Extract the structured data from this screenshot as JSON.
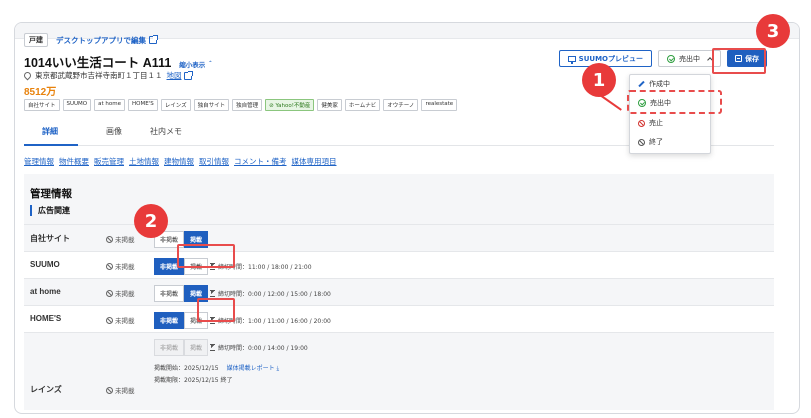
{
  "header": {
    "badge": "戸建",
    "edit_link": "デスクトップアプリで編集",
    "title": "1014いい生活コート A111",
    "collapse": "縮小表示 ＾",
    "address": "東京都武蔵野市吉祥寺南町１丁目１１",
    "map_link": "地図",
    "price": "8512万"
  },
  "media_tags": [
    "自社サイト",
    "SUUMO",
    "at home",
    "HOME'S",
    "レインズ",
    "独自サイト",
    "独自管理",
    "Yahoo!不動産",
    "健美家",
    "ホームナビ",
    "オウチーノ",
    "realestate"
  ],
  "tabs": [
    "詳細",
    "画像",
    "社内メモ"
  ],
  "anchors": [
    "管理情報",
    "物件概要",
    "販売管理",
    "土地情報",
    "建物情報",
    "取引情報",
    "コメント・備考",
    "媒体専用項目"
  ],
  "actions": {
    "suumo": "SUUMOプレビュー",
    "status": "売出中",
    "save": "保存"
  },
  "dropdown": [
    "作成中",
    "売出中",
    "売止",
    "終了"
  ],
  "panel": {
    "title": "管理情報",
    "subtitle": "広告関連"
  },
  "toggle_labels": {
    "off": "非掲載",
    "on": "掲載"
  },
  "rows": [
    {
      "name": "自社サイト",
      "status": "未掲載",
      "active": "on",
      "deadline": ""
    },
    {
      "name": "SUUMO",
      "status": "未掲載",
      "active": "off",
      "deadline": "締切時間：11:00 / 18:00 / 21:00"
    },
    {
      "name": "at home",
      "status": "未掲載",
      "active": "on",
      "deadline": "締切時間：0:00 / 12:00 / 15:00 / 18:00"
    },
    {
      "name": "HOME'S",
      "status": "未掲載",
      "active": "off",
      "deadline": "締切時間：1:00 / 11:00 / 16:00 / 20:00"
    },
    {
      "name": "レインズ",
      "status": "未掲載",
      "active": "disabled",
      "deadline": "締切時間：0:00 / 14:00 / 19:00",
      "start": "掲載開始：2025/12/15",
      "report": "媒体掲載レポート ⤓",
      "end": "掲載期限：2025/12/15 終了"
    }
  ],
  "steps": [
    "1",
    "2",
    "3"
  ],
  "colors": {
    "accent": "#1f5fbf",
    "highlight": "#e83a3a",
    "price": "#e8820c"
  }
}
